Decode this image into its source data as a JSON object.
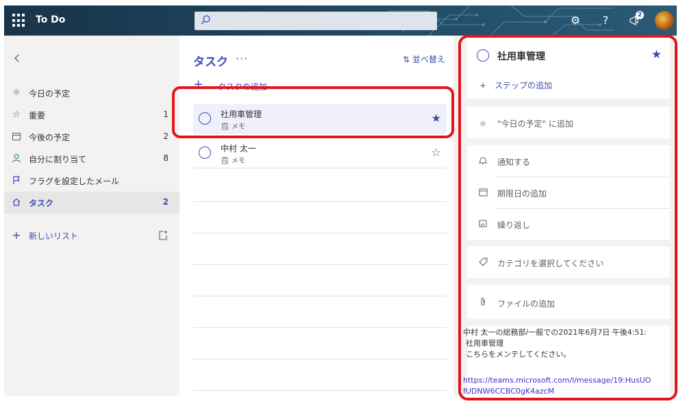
{
  "app": {
    "title": "To Do"
  },
  "topbar": {
    "icons": [
      "waffle-icon",
      "search-icon",
      "gear-icon",
      "help-icon",
      "megaphone-icon"
    ],
    "notification_count": "2"
  },
  "sidebar": {
    "items": [
      {
        "icon": "sun-icon",
        "label": "今日の予定",
        "count": ""
      },
      {
        "icon": "star-icon",
        "label": "重要",
        "count": "1"
      },
      {
        "icon": "calendar-icon",
        "label": "今後の予定",
        "count": "2"
      },
      {
        "icon": "person-icon",
        "label": "自分に割り当て",
        "count": "8"
      },
      {
        "icon": "flag-icon",
        "label": "フラグを設定したメール",
        "count": ""
      },
      {
        "icon": "home-icon",
        "label": "タスク",
        "count": "2"
      }
    ],
    "new_list_label": "新しいリスト"
  },
  "main": {
    "title": "タスク",
    "more": "···",
    "sort_label": "並べ替え",
    "add_task_label": "タスクの追加",
    "tasks": [
      {
        "title": "社用車管理",
        "meta": "メモ",
        "important": true
      },
      {
        "title": "中村 太一",
        "meta": "メモ",
        "important": false
      }
    ]
  },
  "detail": {
    "title": "社用車管理",
    "add_step": "ステップの追加",
    "add_today": "\"今日の予定\" に追加",
    "remind": "通知する",
    "due": "期限日の追加",
    "repeat": "繰り返し",
    "category": "カテゴリを選択してください",
    "file": "ファイルの追加",
    "note_line1": "中村 太一の総務部/一般での2021年6月7日 午後4:51:",
    "note_line2": "社用車管理",
    "note_line3": "こちらをメンテしてください。",
    "note_link": "https://teams.microsoft.com/l/message/19:HusUOfUDNW6CCBC0gK4azcM"
  },
  "colors": {
    "accent": "#3b4bb3",
    "highlight": "#e3141e",
    "topbar": "#1f4560"
  }
}
